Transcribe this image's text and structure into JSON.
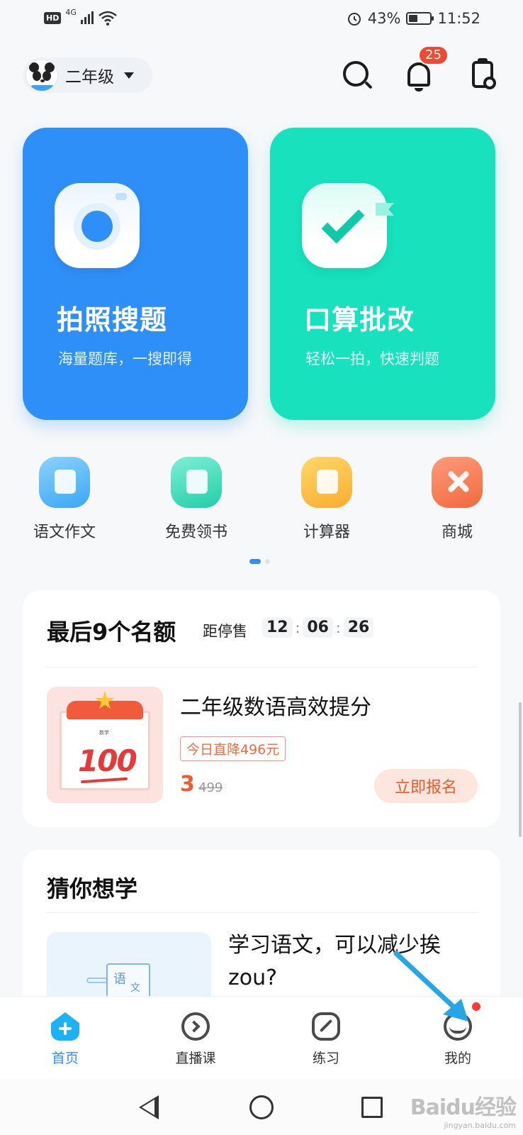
{
  "status_bar": {
    "hd": "HD",
    "network": "4G",
    "battery_percent": "43%",
    "battery_level": 0.43,
    "time": "11:52"
  },
  "header": {
    "grade_selector": "二年级",
    "notification_count": "25",
    "icons": [
      "panda-avatar-icon",
      "search-icon",
      "bell-icon",
      "clipboard-clock-icon"
    ]
  },
  "hero_cards": [
    {
      "title": "拍照搜题",
      "subtitle": "海量题库，一搜即得",
      "color": "#2f8ff8",
      "icon": "camera-icon"
    },
    {
      "title": "口算批改",
      "subtitle": "轻松一拍，快速判题",
      "color": "#17e2bd",
      "icon": "check-icon"
    }
  ],
  "quick_entries": [
    {
      "label": "语文作文",
      "icon": "composition-icon"
    },
    {
      "label": "免费领书",
      "icon": "free-book-icon"
    },
    {
      "label": "计算器",
      "icon": "calculator-icon"
    },
    {
      "label": "商城",
      "icon": "mall-icon"
    }
  ],
  "pager": {
    "pages": 2,
    "active": 1
  },
  "promo": {
    "title": "最后9个名额",
    "countdown_label": "距停售",
    "countdown": [
      "12",
      "06",
      "26"
    ],
    "course_name": "二年级数语高效提分",
    "thumb_caption": "数学",
    "thumb_score": "100",
    "discount": "今日直降496元",
    "price": "3",
    "original_price": "499",
    "cta": "立即报名"
  },
  "guess": {
    "title": "猜你想学",
    "thumb_text_1": "语",
    "thumb_text_2": "文",
    "article_title": "学习语文，可以减少挨zou?"
  },
  "tabs": [
    {
      "label": "首页",
      "icon": "home-icon",
      "active": true
    },
    {
      "label": "直播课",
      "icon": "live-class-icon",
      "active": false
    },
    {
      "label": "练习",
      "icon": "practice-icon",
      "active": false
    },
    {
      "label": "我的",
      "icon": "profile-icon",
      "active": false,
      "red_dot": true
    }
  ],
  "watermark": {
    "main": "Baidu经验",
    "sub": "jingyan.baidu.com"
  }
}
